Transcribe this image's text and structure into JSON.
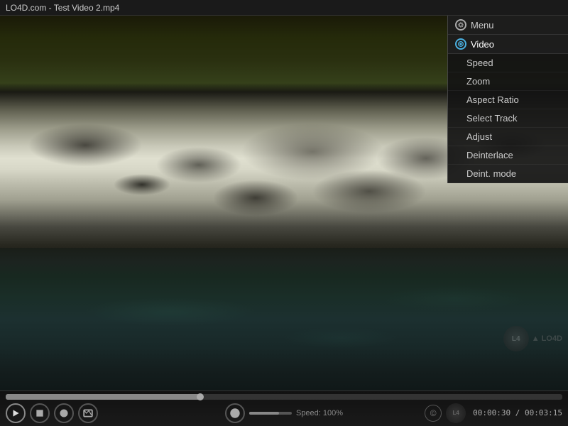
{
  "titleBar": {
    "title": "LO4D.com - Test Video 2.mp4"
  },
  "contextMenu": {
    "menuHeader": {
      "label": "Menu",
      "icon": "gear-icon"
    },
    "videoHeader": {
      "label": "Video",
      "icon": "video-icon"
    },
    "items": [
      {
        "label": "Speed",
        "id": "speed"
      },
      {
        "label": "Zoom",
        "id": "zoom"
      },
      {
        "label": "Aspect Ratio",
        "id": "aspect-ratio"
      },
      {
        "label": "Select Track",
        "id": "select-track"
      },
      {
        "label": "Adjust",
        "id": "adjust"
      },
      {
        "label": "Deinterlace",
        "id": "deinterlace"
      },
      {
        "label": "Deint. mode",
        "id": "deint-mode"
      }
    ]
  },
  "controls": {
    "playButton": "▶",
    "stopButton": "■",
    "fullscreenButton": "⛶",
    "recordButton": "⏺",
    "menuButton": "☰",
    "copyrightButton": "©",
    "speedLabel": "Speed: 100%",
    "timeDisplay": "00:00:30 / 00:03:15",
    "progressPercent": 35,
    "volumePercent": 70
  },
  "watermark": {
    "logo": "LO4D",
    "text": "▲ LO4D"
  }
}
